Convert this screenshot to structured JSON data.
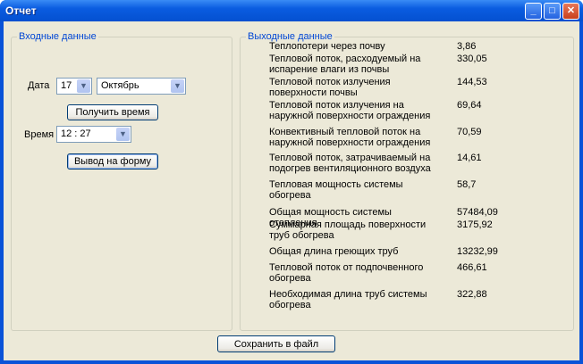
{
  "window": {
    "title": "Отчет",
    "minimize": "_",
    "maximize": "□",
    "close": "✕"
  },
  "input_group": {
    "label": "Входные данные",
    "date_label": "Дата",
    "day": "17",
    "month": "Октябрь",
    "get_time_button": "Получить время",
    "time_label": "Время",
    "time": "12 : 27",
    "output_button": "Вывод на форму"
  },
  "output_group": {
    "label": "Выходные данные",
    "rows": [
      {
        "label": "Теплопотери через почву",
        "value": "3,86"
      },
      {
        "label": "Тепловой поток, расходуемый на испарение влаги из почвы",
        "value": "330,05"
      },
      {
        "label": "Тепловой поток излучения поверхности почвы",
        "value": "144,53"
      },
      {
        "label": "Тепловой поток излучения на наружной поверхности ограждения",
        "value": "69,64"
      },
      {
        "label": "Конвективный тепловой поток на наружной поверхности ограждения",
        "value": "70,59"
      },
      {
        "label": "Тепловой поток, затрачиваемый на подогрев вентиляционного воздуха",
        "value": "14,61"
      },
      {
        "label": "Тепловая мощность системы обогрева",
        "value": "58,7"
      },
      {
        "label": "Общая мощность системы отопления",
        "value": "57484,09"
      },
      {
        "label": "Суммарная площадь поверхности труб обогрева",
        "value": "3175,92"
      },
      {
        "label": "Общая длина греющих труб",
        "value": "13232,99"
      },
      {
        "label": "Тепловой поток от подпочвенного обогрева",
        "value": "466,61"
      },
      {
        "label": "Необходимая длина труб системы обогрева",
        "value": "322,88"
      }
    ]
  },
  "save_button": "Сохранить в файл"
}
